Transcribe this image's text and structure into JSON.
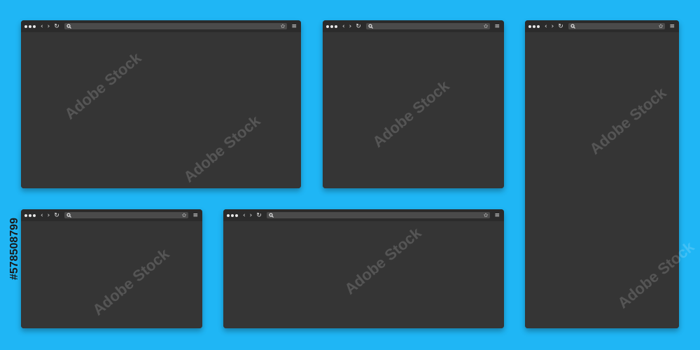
{
  "colors": {
    "background": "#1fb6f5",
    "window_body": "#353535",
    "toolbar": "#2b2b2b",
    "address_bar": "#4a4a4a",
    "icon": "#e6e6e6"
  },
  "windows": [
    {
      "id": "w1",
      "icons": [
        "window-controls-dots",
        "back-icon",
        "forward-icon",
        "reload-icon",
        "search-icon",
        "star-icon",
        "menu-icon"
      ]
    },
    {
      "id": "w2",
      "icons": [
        "window-controls-dots",
        "back-icon",
        "forward-icon",
        "reload-icon",
        "search-icon",
        "star-icon",
        "menu-icon"
      ]
    },
    {
      "id": "w3",
      "icons": [
        "window-controls-dots",
        "back-icon",
        "forward-icon",
        "reload-icon",
        "search-icon",
        "star-icon",
        "menu-icon"
      ]
    },
    {
      "id": "w4",
      "icons": [
        "window-controls-dots",
        "back-icon",
        "forward-icon",
        "reload-icon",
        "search-icon",
        "star-icon",
        "menu-icon"
      ]
    },
    {
      "id": "w5",
      "icons": [
        "window-controls-dots",
        "back-icon",
        "forward-icon",
        "reload-icon",
        "search-icon",
        "star-icon",
        "menu-icon"
      ]
    }
  ],
  "glyphs": {
    "back": "‹",
    "forward": "›",
    "reload": "↻",
    "star": "✩",
    "menu": "≡"
  },
  "watermark": {
    "text": "Adobe Stock",
    "stock_id": "#578508799"
  }
}
